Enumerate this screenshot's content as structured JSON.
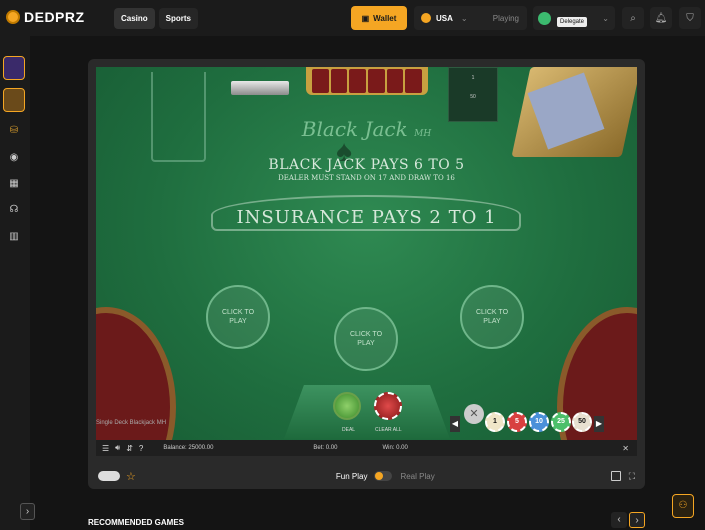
{
  "header": {
    "logo": "DEDPRZ",
    "tabs": [
      {
        "label": "Casino"
      },
      {
        "label": "Sports"
      }
    ],
    "wallet_label": "Wallet",
    "currency": "USA",
    "playing_label": "Playing",
    "user_tooltip": "Delegate"
  },
  "game": {
    "brand": "Black Jack",
    "brand_sup": "MH",
    "rule_line1": "BLACK JACK PAYS 6 TO 5",
    "rule_line2": "DEALER MUST STAND ON 17 AND DRAW TO 16",
    "rule_line3": "INSURANCE PAYS 2 TO 1",
    "scoreboard": {
      "top": "1",
      "bottom": "50"
    },
    "bet_spots": [
      "CLICK TO PLAY",
      "CLICK TO PLAY",
      "CLICK TO PLAY"
    ],
    "deal_label": "DEAL",
    "clear_label": "CLEAR ALL",
    "title": "Single Deck Blackjack MH",
    "chips": [
      {
        "value": "1",
        "color": "#f0e6c8"
      },
      {
        "value": "5",
        "color": "#d84040"
      },
      {
        "value": "10",
        "color": "#4a90d9"
      },
      {
        "value": "25",
        "color": "#4cbf6a"
      },
      {
        "value": "50",
        "color": "#e8e0d0"
      }
    ],
    "status": {
      "balance": "Balance: 25000.00",
      "bet": "Bet: 0.00",
      "win": "Win: 0.00"
    }
  },
  "toolbar": {
    "fun_play": "Fun Play",
    "real_play": "Real Play"
  },
  "recommended_title": "RECOMMENDED GAMES"
}
